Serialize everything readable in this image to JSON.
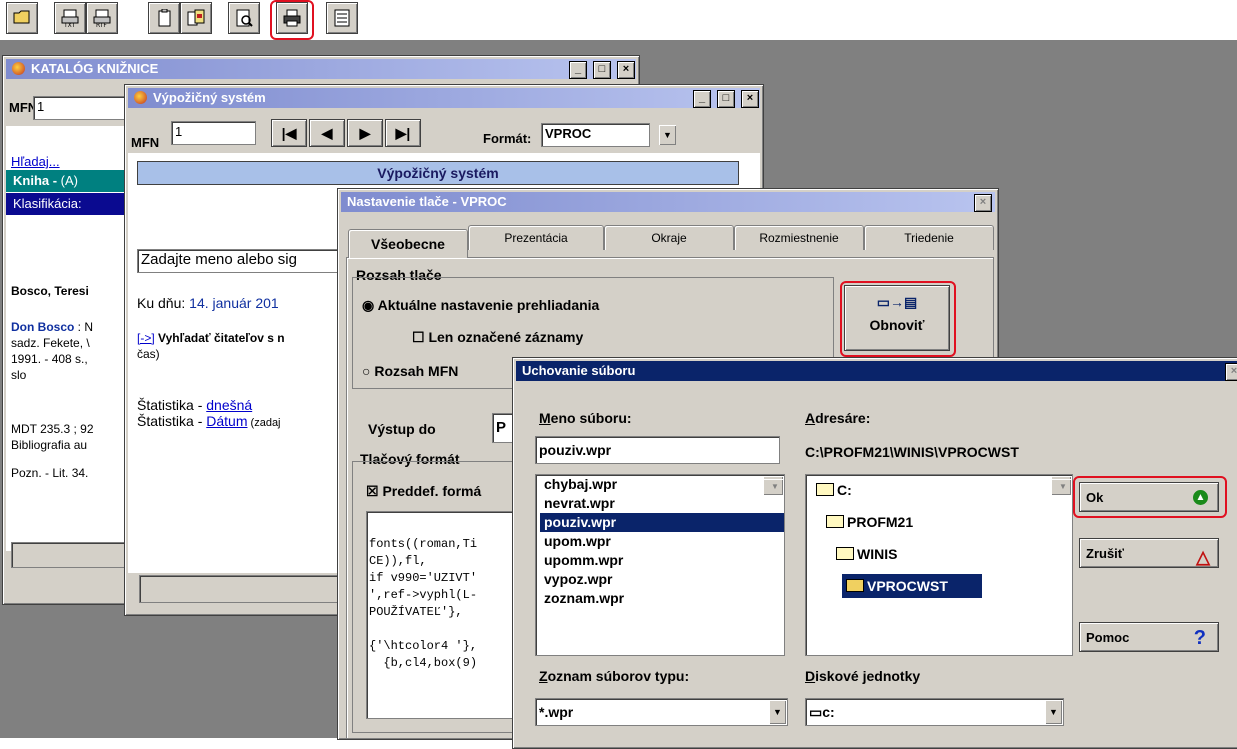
{
  "toolbar": {
    "icons": [
      "open-folder-icon",
      "print-txt-icon",
      "print-rtf-icon",
      "clipboard-icon",
      "copy-records-icon",
      "preview-icon",
      "printer-icon",
      "form-icon"
    ]
  },
  "katalog": {
    "title": "KATALÓG KNIŽNICE",
    "mfn_label": "MFN",
    "mfn_value": "1",
    "search_link": "Hľadaj...",
    "kniha_label": "Kniha - ",
    "kniha_suffix": "(A)",
    "klasifikacia_label": "Klasifikácia:",
    "author": "Bosco, Teresi",
    "record_line1": "Don Bosco",
    "record_line1_rest": " : N",
    "record_line2": "sadz. Fekete, \\",
    "record_line3": "1991. - 408 s.,",
    "record_line4": "slo",
    "mdt_line": "MDT 235.3 ; 92",
    "biblio_line": "Bibliografia au",
    "pozn_line": "Pozn. - Lit. 34."
  },
  "vypoz": {
    "title": "Výpožičný systém",
    "mfn_label": "MFN",
    "mfn_value": "1",
    "format_label": "Formát:",
    "format_value": "VPROC",
    "banner": "Výpožičný systém",
    "name_prompt": "Zadajte meno alebo sig",
    "date_prefix": "Ku dňu: ",
    "date_value": "14. január 201",
    "search_link": "[->]",
    "search_text": " Vyhľadať čitateľov s n",
    "search_text2": "čas)",
    "stat1_prefix": "Štatistika - ",
    "stat1_link": "dnešná",
    "stat2_prefix": "Štatistika - ",
    "stat2_link": "Dátum",
    "stat2_suffix": " (zadaj"
  },
  "print_dialog": {
    "title": "Nastavenie tlače - VPROC",
    "tabs": [
      "Všeobecne",
      "Prezentácia",
      "Okraje",
      "Rozmiestnenie",
      "Triedenie"
    ],
    "range_group": "Rozsah tlače",
    "opt_current": "Aktuálne nastavenie prehliadania",
    "opt_marked": "Len označené záznamy",
    "opt_mfn": "Rozsah MFN",
    "refresh_label": "Obnoviť",
    "output_label": "Výstup do",
    "output_value": "P",
    "format_group": "Tlačový formát",
    "predef_label": "Preddef. formá",
    "code_lines": [
      "fonts((roman,Ti",
      "CE)),fl,",
      "if v990='UZIVT'",
      "',ref->vyphl(L-",
      "POUŽÍVATEĽ'},",
      "",
      "{'\\htcolor4 '},",
      "  {b,cl4,box(9)"
    ]
  },
  "save_dialog": {
    "title": "Uchovanie súboru",
    "filename_label": "Meno súboru:",
    "filename_value": "pouziv.wpr",
    "files": [
      "chybaj.wpr",
      "nevrat.wpr",
      "pouziv.wpr",
      "upom.wpr",
      "upomm.wpr",
      "vypoz.wpr",
      "zoznam.wpr"
    ],
    "selected_file": "pouziv.wpr",
    "dirs_label": "Adresáre:",
    "current_path": "C:\\PROFM21\\WINIS\\VPROCWST",
    "dirs": [
      "C:",
      "PROFM21",
      "WINIS",
      "VPROCWST"
    ],
    "ok_label": "Ok",
    "cancel_label": "Zrušiť",
    "help_label": "Pomoc",
    "filetype_label": "Zoznam súborov typu:",
    "filetype_value": "*.wpr",
    "drives_label": "Diskové jednotky",
    "drive_value": "c:"
  },
  "colors": {
    "highlight_red": "#e01020",
    "selection_blue": "#0a246a",
    "banner_blue": "#a8c0e8",
    "teal_row": "#008080"
  }
}
